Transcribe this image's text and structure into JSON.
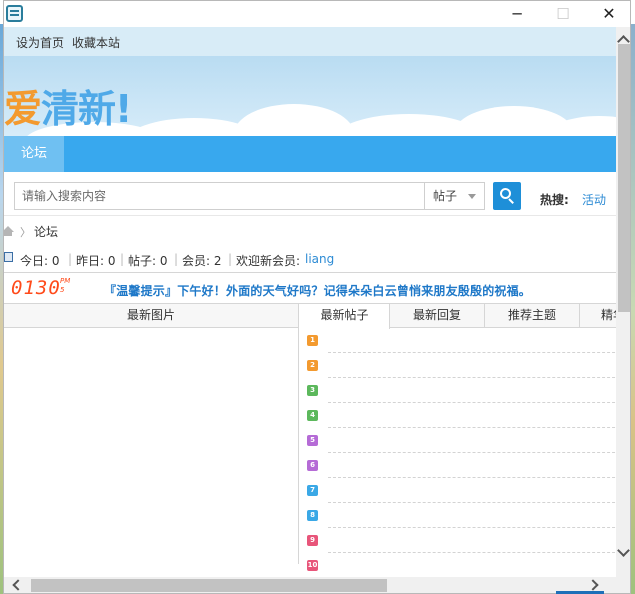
{
  "window": {
    "minimize_glyph": "─",
    "maximize_glyph": "☐",
    "close_glyph": "✕"
  },
  "topbar": {
    "set_home": "设为首页",
    "bookmark": "收藏本站"
  },
  "banner": {
    "logo_part1": "爱",
    "logo_part2": "清新!"
  },
  "nav": {
    "items": [
      "论坛"
    ]
  },
  "search": {
    "placeholder": "请输入搜索内容",
    "type_selected": "帖子",
    "hot_label": "热搜:",
    "hot_links": [
      "活动"
    ]
  },
  "breadcrumb": {
    "separator": "〉",
    "current": "论坛"
  },
  "stats": {
    "today": "今日: 0",
    "yesterday": "昨日: 0",
    "posts": "帖子: 0",
    "members": "会员: 2",
    "welcome_prefix": "欢迎新会员:",
    "new_member": "liang",
    "divider": "|"
  },
  "notice": {
    "clock": "0130",
    "clock_pm": "PM",
    "clock_seconds": "5",
    "text": "『温馨提示』下午好！外面的天气好吗？记得朵朵白云曾悄来朋友殷殷的祝福。"
  },
  "panes": {
    "images_title": "最新图片",
    "tabs": [
      "最新帖子",
      "最新回复",
      "推荐主题",
      "精华"
    ],
    "active_tab": 0,
    "row_numbers": [
      "1",
      "2",
      "3",
      "4",
      "5",
      "6",
      "7",
      "8",
      "9",
      "10"
    ],
    "row_colors": [
      "#f39a2f",
      "#f39a2f",
      "#5cb85c",
      "#5cb85c",
      "#b56bd6",
      "#b56bd6",
      "#3aa8e6",
      "#3aa8e6",
      "#e8557a",
      "#e8557a"
    ]
  },
  "colors": {
    "nav_bg": "#38a8ee",
    "accent": "#1e8fd8",
    "link": "#2d8bd4",
    "clock": "#ff4a1a"
  }
}
